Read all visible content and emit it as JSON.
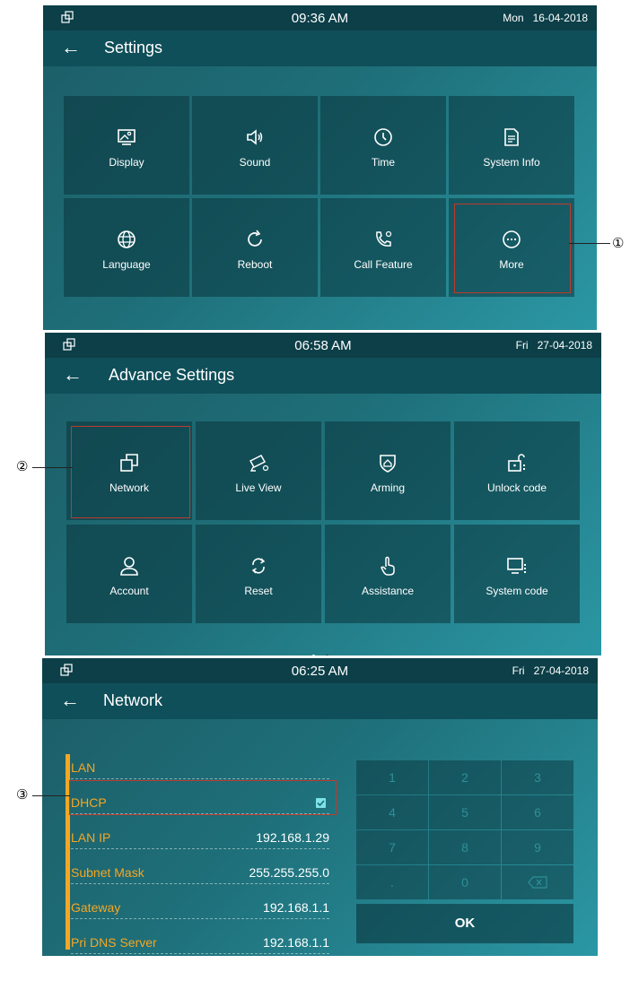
{
  "panel1": {
    "clock": "09:36 AM",
    "day": "Mon",
    "date": "16-04-2018",
    "title": "Settings",
    "tiles": [
      {
        "label": "Display",
        "icon": "display-icon"
      },
      {
        "label": "Sound",
        "icon": "sound-icon"
      },
      {
        "label": "Time",
        "icon": "clock-icon"
      },
      {
        "label": "System Info",
        "icon": "document-icon"
      },
      {
        "label": "Language",
        "icon": "globe-icon"
      },
      {
        "label": "Reboot",
        "icon": "reboot-icon"
      },
      {
        "label": "Call Feature",
        "icon": "phone-gear-icon"
      },
      {
        "label": "More",
        "icon": "more-icon"
      }
    ],
    "callout": "①"
  },
  "panel2": {
    "clock": "06:58 AM",
    "day": "Fri",
    "date": "27-04-2018",
    "title": "Advance Settings",
    "tiles": [
      {
        "label": "Network",
        "icon": "network-icon"
      },
      {
        "label": "Live View",
        "icon": "camera-icon"
      },
      {
        "label": "Arming",
        "icon": "shield-icon"
      },
      {
        "label": "Unlock code",
        "icon": "unlock-icon"
      },
      {
        "label": "Account",
        "icon": "user-icon"
      },
      {
        "label": "Reset",
        "icon": "reset-icon"
      },
      {
        "label": "Assistance",
        "icon": "hand-icon"
      },
      {
        "label": "System code",
        "icon": "monitor-icon"
      }
    ],
    "callout": "②"
  },
  "panel3": {
    "clock": "06:25 AM",
    "day": "Fri",
    "date": "27-04-2018",
    "title": "Network",
    "rows": [
      {
        "key": "LAN",
        "value": ""
      },
      {
        "key": "DHCP",
        "value": ""
      },
      {
        "key": "LAN IP",
        "value": "192.168.1.29"
      },
      {
        "key": "Subnet Mask",
        "value": "255.255.255.0"
      },
      {
        "key": "Gateway",
        "value": "192.168.1.1"
      },
      {
        "key": "Pri DNS Server",
        "value": "192.168.1.1"
      }
    ],
    "keypad": [
      "1",
      "2",
      "3",
      "4",
      "5",
      "6",
      "7",
      "8",
      "9",
      ".",
      "0"
    ],
    "ok_label": "OK",
    "callout": "③"
  },
  "colors": {
    "accent": "#f5a623",
    "highlight": "#c0392b",
    "statusbar": "#0c3f48"
  }
}
